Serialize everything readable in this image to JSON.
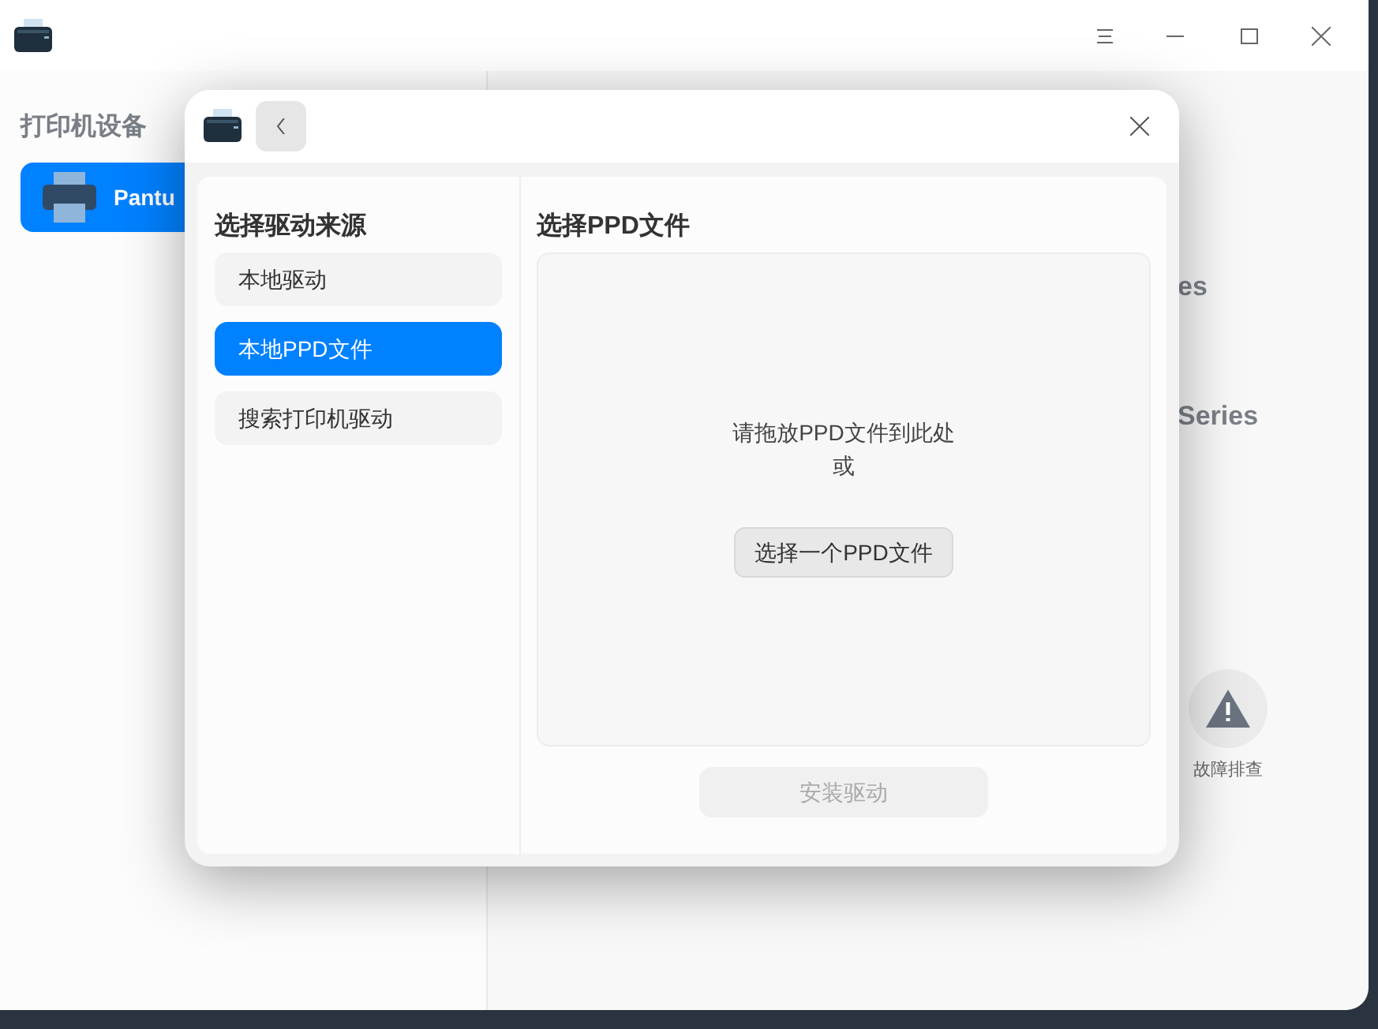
{
  "main_window": {
    "sidebar": {
      "title": "打印机设备",
      "items": [
        {
          "label": "Pantu",
          "selected": true
        }
      ]
    },
    "content": {
      "texts": [
        "es",
        "Series"
      ],
      "troubleshoot": {
        "label": "故障排查"
      }
    }
  },
  "dialog": {
    "sources": {
      "title": "选择驱动来源",
      "items": [
        {
          "label": "本地驱动",
          "selected": false
        },
        {
          "label": "本地PPD文件",
          "selected": true
        },
        {
          "label": "搜索打印机驱动",
          "selected": false
        }
      ]
    },
    "ppd": {
      "title": "选择PPD文件",
      "drop_hint": "请拖放PPD文件到此处",
      "or": "或",
      "choose_button": "选择一个PPD文件"
    },
    "install_button": {
      "label": "安装驱动",
      "disabled": true
    }
  }
}
